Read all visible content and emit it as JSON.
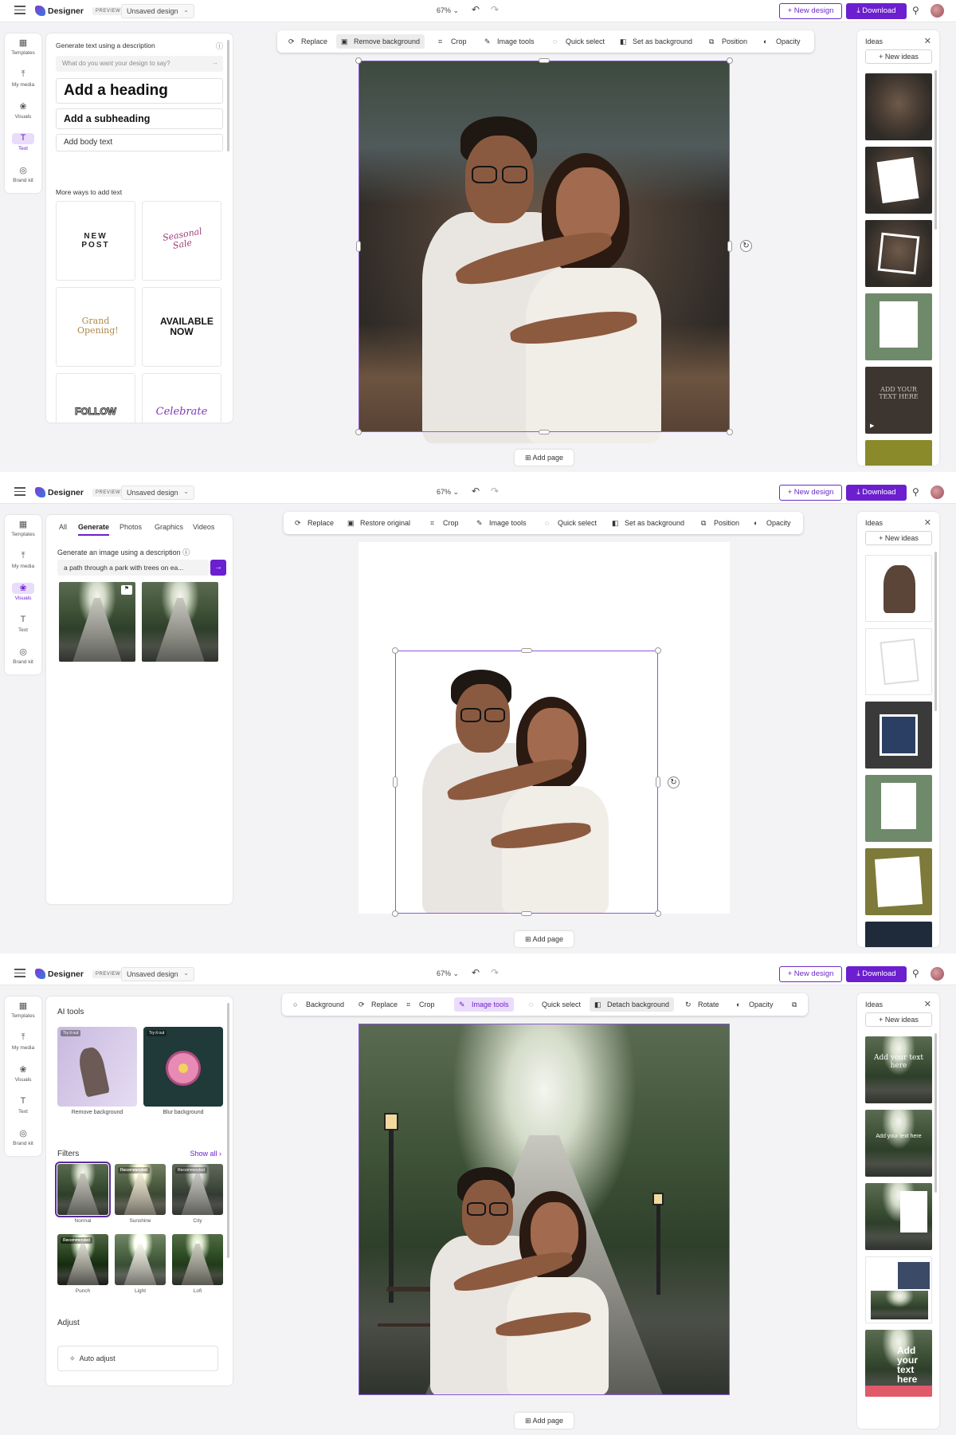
{
  "app": {
    "brand": "Designer",
    "preview_badge": "PREVIEW",
    "design_title": "Unsaved design",
    "zoom": "67%",
    "new_design": "+ New design",
    "download": "Download"
  },
  "rail": [
    {
      "label": "Templates",
      "icon": "templates-icon"
    },
    {
      "label": "My media",
      "icon": "upload-icon"
    },
    {
      "label": "Visuals",
      "icon": "visuals-icon"
    },
    {
      "label": "Text",
      "icon": "text-icon"
    },
    {
      "label": "Brand kit",
      "icon": "brand-kit-icon"
    }
  ],
  "add_page": "Add page",
  "ideas": {
    "title": "Ideas",
    "new_ideas": "+ New ideas"
  },
  "frame1": {
    "panel": {
      "heading": "Generate text using a description",
      "placeholder": "What do you want your design to say?",
      "add_heading": "Add a heading",
      "add_subheading": "Add a subheading",
      "add_body": "Add body text",
      "more_ways": "More ways to add text",
      "tiles": [
        "NEW POST",
        "Seasonal Sale",
        "Grand Opening!",
        "AVAILABLE NOW",
        "FOLLOW",
        "Celebrate"
      ]
    },
    "toolbar": [
      "Replace",
      "Remove background",
      "Crop",
      "Image tools",
      "Quick select",
      "Set as background",
      "Position",
      "Opacity"
    ],
    "idea_last_text": "ADD YOUR TEXT HERE"
  },
  "frame2": {
    "tabs": [
      "All",
      "Generate",
      "Photos",
      "Graphics",
      "Videos"
    ],
    "gen_label": "Generate an image using a description",
    "gen_value": "a path through a park with trees on ea...",
    "toolbar": [
      "Replace",
      "Restore original",
      "Crop",
      "Image tools",
      "Quick select",
      "Set as background",
      "Position",
      "Opacity"
    ]
  },
  "frame3": {
    "ai_tools_title": "AI tools",
    "ai_tools": [
      {
        "label": "Remove background",
        "badge": "Try it out"
      },
      {
        "label": "Blur background",
        "badge": "Try it out"
      }
    ],
    "filters_title": "Filters",
    "show_all": "Show all ›",
    "filters": [
      {
        "label": "Normal",
        "badge": ""
      },
      {
        "label": "Sunshine",
        "badge": "Recommended"
      },
      {
        "label": "City",
        "badge": "Recommended"
      },
      {
        "label": "Punch",
        "badge": "Recommended"
      },
      {
        "label": "Light",
        "badge": ""
      },
      {
        "label": "Lofi",
        "badge": ""
      }
    ],
    "adjust_title": "Adjust",
    "auto_adjust": "Auto adjust",
    "toolbar": [
      "Background",
      "Replace",
      "Crop",
      "Image tools",
      "Quick select",
      "Detach background",
      "Rotate",
      "Opacity"
    ],
    "ideas_texts": [
      "Add your text here",
      "Add your text here",
      "Add your text here"
    ]
  },
  "colors": {
    "accent": "#6b1fcf",
    "selection": "#8b5ad8"
  }
}
